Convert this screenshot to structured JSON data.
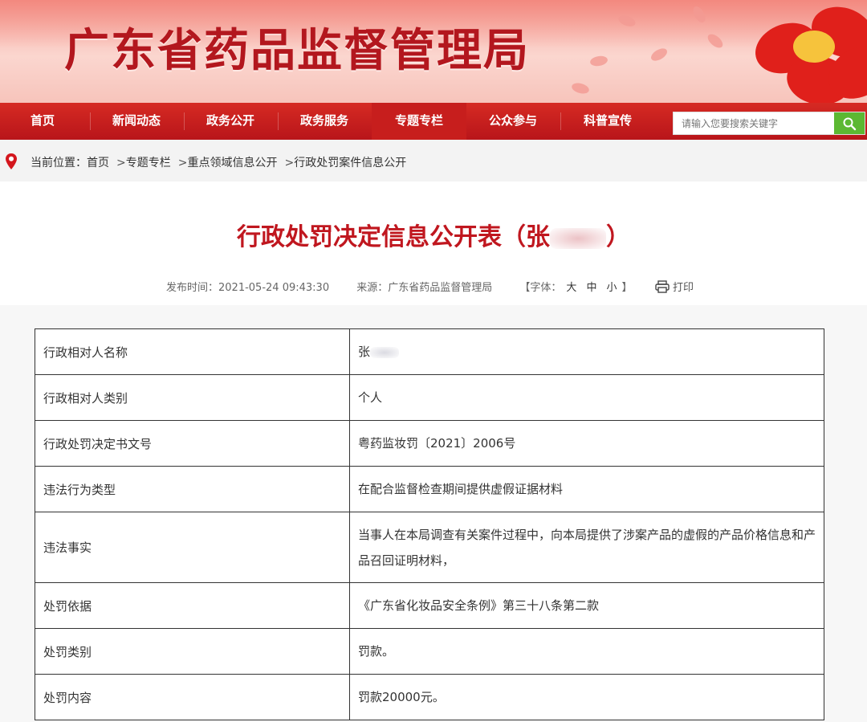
{
  "site": {
    "title": "广东省药品监督管理局"
  },
  "nav": {
    "items": [
      {
        "label": "首页"
      },
      {
        "label": "新闻动态"
      },
      {
        "label": "政务公开"
      },
      {
        "label": "政务服务"
      },
      {
        "label": "专题专栏",
        "active": true
      },
      {
        "label": "公众参与"
      },
      {
        "label": "科普宣传"
      }
    ],
    "search": {
      "placeholder": "请输入您要搜索关键字",
      "icon": "search-icon"
    }
  },
  "breadcrumb": {
    "prefix": "当前位置：",
    "items": [
      "首页",
      "专题专栏",
      "重点领域信息公开",
      "行政处罚案件信息公开"
    ],
    "separator": ">"
  },
  "article": {
    "title_prefix": "行政处罚决定信息公开表（张",
    "title_suffix": "）",
    "publish_label": "发布时间：",
    "publish_time": "2021-05-24 09:43:30",
    "source_label": "来源：",
    "source": "广东省药品监督管理局",
    "font_label": "【字体：",
    "font_sizes": [
      "大",
      "中",
      "小"
    ],
    "font_close": "】",
    "print_label": "打印"
  },
  "table": {
    "rows": [
      {
        "key": "行政相对人名称",
        "value": "张"
      },
      {
        "key": "行政相对人类别",
        "value": "个人"
      },
      {
        "key": "行政处罚决定书文号",
        "value": "粤药监妆罚〔2021〕2006号"
      },
      {
        "key": "违法行为类型",
        "value": "在配合监督检查期间提供虚假证据材料"
      },
      {
        "key": "违法事实",
        "value": "当事人在本局调查有关案件过程中，向本局提供了涉案产品的虚假的产品价格信息和产品召回证明材料，"
      },
      {
        "key": "处罚依据",
        "value": "《广东省化妆品安全条例》第三十八条第二款"
      },
      {
        "key": "处罚类别",
        "value": "罚款。"
      },
      {
        "key": "处罚内容",
        "value": "罚款20000元。"
      }
    ]
  },
  "colors": {
    "brand_red": "#c0171f",
    "nav_red": "#c71e1d",
    "search_green": "#5cb832"
  }
}
